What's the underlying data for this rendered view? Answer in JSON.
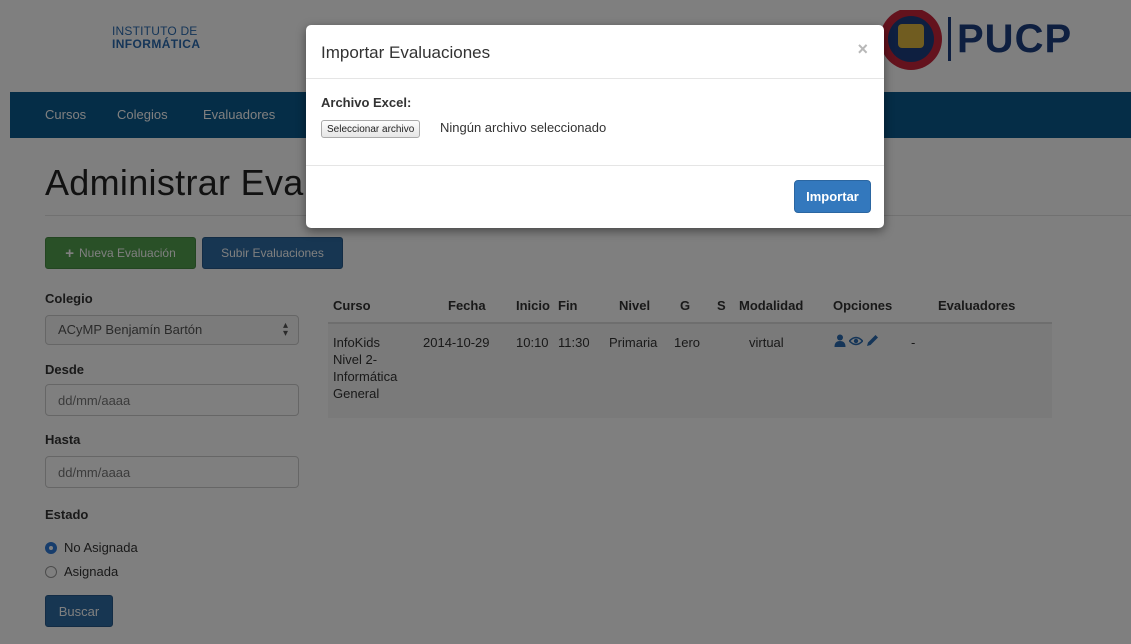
{
  "header": {
    "institute_line1": "INSTITUTO DE",
    "institute_line2": "INFORMÁTICA",
    "brand": "PUCP"
  },
  "nav": {
    "items": [
      "Cursos",
      "Colegios",
      "Evaluadores"
    ]
  },
  "page": {
    "title": "Administrar Eval"
  },
  "toolbar": {
    "new_label": "Nueva Evaluación",
    "upload_label": "Subir Evaluaciones"
  },
  "filters": {
    "colegio_label": "Colegio",
    "colegio_value": "ACyMP Benjamín Bartón",
    "desde_label": "Desde",
    "desde_placeholder": "dd/mm/aaaa",
    "hasta_label": "Hasta",
    "hasta_placeholder": "dd/mm/aaaa",
    "estado_label": "Estado",
    "estado_options": [
      {
        "label": "No Asignada",
        "selected": true
      },
      {
        "label": "Asignada",
        "selected": false
      }
    ],
    "search_label": "Buscar"
  },
  "table": {
    "headers": [
      "Curso",
      "Fecha",
      "Inicio",
      "Fin",
      "Nivel",
      "G",
      "S",
      "Modalidad",
      "Opciones",
      "Evaluadores"
    ],
    "rows": [
      {
        "curso_lines": [
          "InfoKids",
          "Nivel 2-",
          "Informática",
          "General"
        ],
        "fecha": "2014-10-29",
        "inicio": "10:10",
        "fin": "11:30",
        "nivel": "Primaria",
        "g": "1ero",
        "s": "",
        "modalidad": "virtual",
        "opciones_icons": [
          "user-icon",
          "eye-icon",
          "pencil-icon"
        ],
        "evaluadores": "-"
      }
    ]
  },
  "modal": {
    "title": "Importar Evaluaciones",
    "close": "×",
    "file_label": "Archivo Excel:",
    "file_button": "Seleccionar archivo",
    "file_status": "Ningún archivo seleccionado",
    "submit": "Importar"
  },
  "colors": {
    "nav_bg": "#0b5a8f",
    "brand": "#1c3f80",
    "primary": "#2e6da4",
    "success": "#52a04f"
  }
}
